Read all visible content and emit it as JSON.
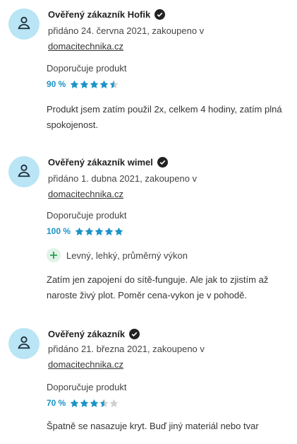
{
  "reviews": [
    {
      "author": "Ověřený zákazník Hofik",
      "meta_prefix": "přidáno 24. června 2021, zakoupeno v",
      "shop": "domacitechnika.cz",
      "recommend": "Doporučuje produkt",
      "rating_percent": "90 %",
      "rating_fraction": 0.9,
      "pros": [],
      "text": "Produkt jsem zatím použil 2x, celkem 4 hodiny, zatím plná spokojenost."
    },
    {
      "author": "Ověřený zákazník wimel",
      "meta_prefix": "přidáno 1. dubna 2021, zakoupeno v",
      "shop": "domacitechnika.cz",
      "recommend": "Doporučuje produkt",
      "rating_percent": "100 %",
      "rating_fraction": 1.0,
      "pros": [
        "Levný, lehký, průměrný výkon"
      ],
      "text": "Zatím jen zapojení do sítě-funguje. Ale jak to zjistím až naroste živý plot. Poměr cena-vykon je v pohodě."
    },
    {
      "author": "Ověřený zákazník",
      "meta_prefix": "přidáno 21. března 2021, zakoupeno v",
      "shop": "domacitechnika.cz",
      "recommend": "Doporučuje produkt",
      "rating_percent": "70 %",
      "rating_fraction": 0.7,
      "pros": [],
      "text": "Špatně se nasazuje kryt. Buď jiný materiál nebo tvar"
    }
  ],
  "colors": {
    "avatar_bg": "#b9e5f5",
    "star_filled": "#1b93c7",
    "star_empty": "#d0d0d0",
    "percent": "#1b93c7",
    "plus": "#2e9d4f"
  },
  "icons": {
    "avatar": "user-icon",
    "verified": "verified-check-icon",
    "star": "star-icon",
    "pro": "plus-icon"
  }
}
